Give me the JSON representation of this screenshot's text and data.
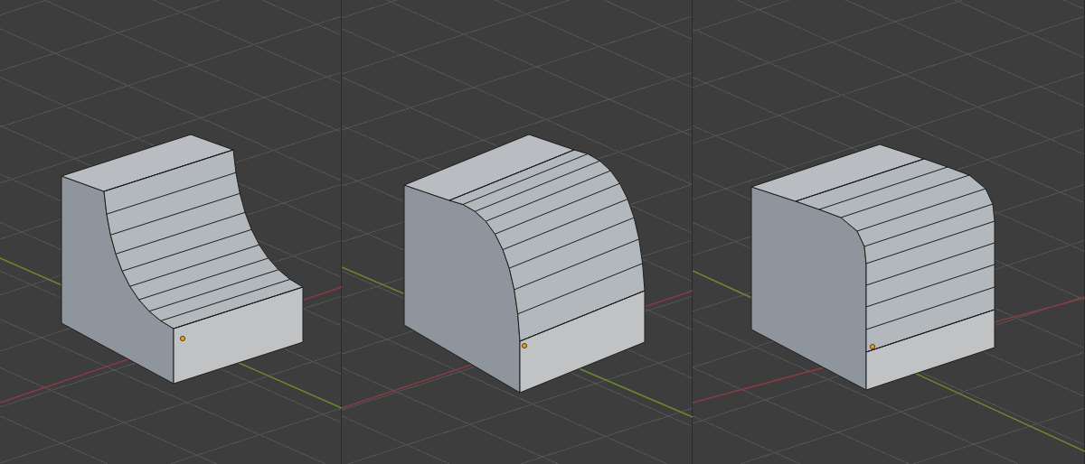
{
  "viewports": [
    {
      "kind": "concave"
    },
    {
      "kind": "convex"
    },
    {
      "kind": "fillet"
    }
  ]
}
